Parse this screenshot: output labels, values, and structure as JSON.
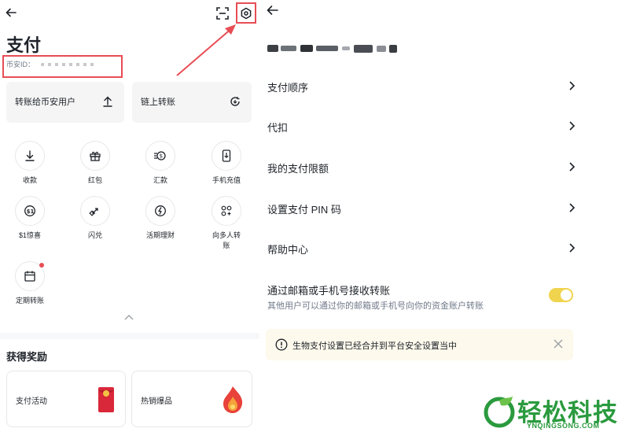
{
  "left": {
    "title": "支付",
    "uid_label": "币安ID：",
    "cards": [
      {
        "label": "转账给币安用户",
        "icon": "upload-icon"
      },
      {
        "label": "链上转账",
        "icon": "chain-transfer-icon"
      }
    ],
    "grid": [
      {
        "label": "收款",
        "icon": "download-icon"
      },
      {
        "label": "红包",
        "icon": "gift-icon"
      },
      {
        "label": "汇款",
        "icon": "remittance-icon"
      },
      {
        "label": "手机充值",
        "icon": "phone-topup-icon"
      },
      {
        "label": "$1惊喜",
        "icon": "dollar-coin-icon"
      },
      {
        "label": "闪兑",
        "icon": "swap-icon"
      },
      {
        "label": "活期理财",
        "icon": "flexible-savings-icon"
      },
      {
        "label": "向多人转账",
        "icon": "batch-transfer-icon"
      },
      {
        "label": "定期转账",
        "icon": "calendar-icon"
      }
    ],
    "rewards_title": "获得奖励",
    "rewards": [
      {
        "label": "支付活动",
        "icon": "red-envelope-icon"
      },
      {
        "label": "热销爆品",
        "icon": "hot-flame-icon"
      }
    ]
  },
  "right": {
    "rows": [
      {
        "label": "支付顺序"
      },
      {
        "label": "代扣"
      },
      {
        "label": "我的支付限额"
      },
      {
        "label": "设置支付 PIN 码"
      },
      {
        "label": "帮助中心"
      }
    ],
    "email_transfer": {
      "title": "通过邮箱或手机号接收转账",
      "subtitle": "其他用户可以通过你的邮箱或手机号向你的资金账户转账",
      "enabled": true
    },
    "notice": "生物支付设置已经合并到平台安全设置当中"
  },
  "watermark": {
    "brand": "轻松科技",
    "url": "YNQINGSONG.COM"
  },
  "colors": {
    "highlight_red": "#e84d55",
    "toggle_yellow": "#f0d44e",
    "notice_bg": "#fdf9ec",
    "brand_green": "#2a9a3e"
  }
}
